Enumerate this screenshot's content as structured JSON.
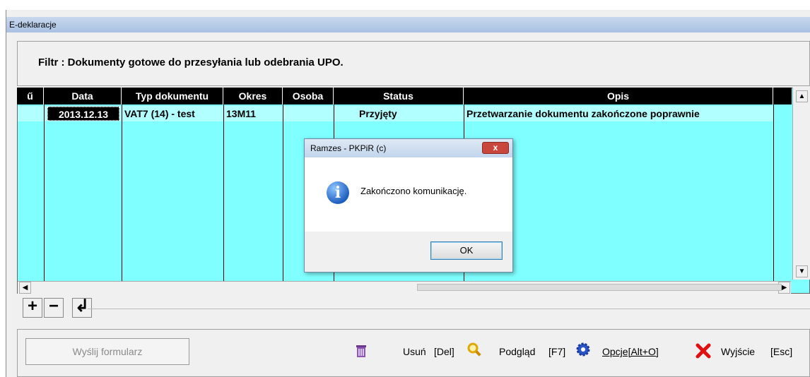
{
  "window": {
    "title": "E-deklaracje"
  },
  "filter": {
    "text": "Filtr : Dokumenty gotowe do przesyłania lub odebrania UPO."
  },
  "table": {
    "columns": [
      "ű",
      "Data",
      "Typ dokumentu",
      "Okres",
      "Osoba",
      "Status",
      "Opis"
    ],
    "rows": [
      {
        "data": "2013.12.13",
        "typ": "VAT7 (14) - test",
        "okres": "13M11",
        "osoba": "",
        "status": "Przyjęty",
        "opis": "Przetwarzanie dokumentu zakończone poprawnie"
      }
    ]
  },
  "nav": {
    "add": "+",
    "remove": "−",
    "return": "↲"
  },
  "toolbar": {
    "send_label": "Wyślij formularz",
    "delete_label": "Usuń",
    "delete_key": "[Del]",
    "preview_label": "Podgląd",
    "preview_key": "[F7]",
    "options_label": "Opcje[Alt+O]",
    "exit_label": "Wyjście",
    "exit_key": "[Esc]"
  },
  "dialog": {
    "title": "Ramzes - PKPiR (c)",
    "message": "Zakończono komunikację.",
    "ok_label": "OK",
    "close_glyph": "x"
  },
  "icons": [
    "trash-icon",
    "magnifier-icon",
    "gear-icon",
    "close-x-icon",
    "info-icon"
  ],
  "colors": {
    "grid_bg": "#7fffff",
    "header_bg": "#000000",
    "selected_row": "#b2ffff"
  }
}
